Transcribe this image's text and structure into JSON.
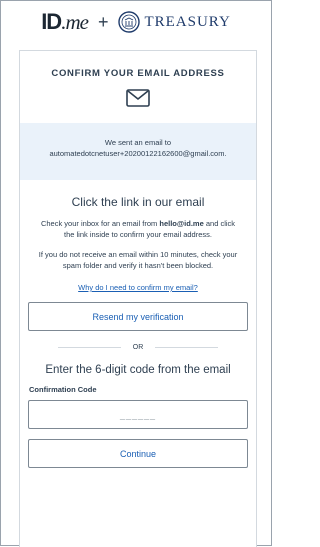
{
  "header": {
    "brand_id": "ID",
    "brand_me": ".me",
    "plus": "+",
    "partner": "TREASURY"
  },
  "card": {
    "title": "CONFIRM YOUR EMAIL ADDRESS",
    "sent_prefix": "We sent an email to",
    "sent_email": "automatedotcnetuser+20200122162600@gmail.com.",
    "heading": "Click the link in our email",
    "instructions_before": "Check your inbox for an email from ",
    "instructions_sender": "hello@id.me",
    "instructions_after": " and click the link inside to confirm your email address.",
    "spam_note": "If you do not receive an email within 10 minutes, check your spam folder and verify it hasn't been blocked.",
    "why_link": "Why do I need to confirm my email?",
    "resend_label": "Resend my verification",
    "or_label": "OR",
    "code_heading": "Enter the 6-digit code from the email",
    "code_label": "Confirmation Code",
    "code_placeholder": "______",
    "continue_label": "Continue"
  },
  "colors": {
    "link": "#1a5fb4",
    "info_bg": "#eaf2fa",
    "text": "#2e3f51"
  }
}
